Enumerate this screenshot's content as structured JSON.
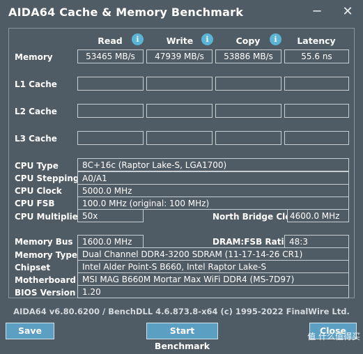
{
  "window": {
    "title": "AIDA64 Cache & Memory Benchmark",
    "minimize_glyph": "─",
    "close_glyph": "✕"
  },
  "columns": {
    "read": "Read",
    "write": "Write",
    "copy": "Copy",
    "latency": "Latency",
    "info_glyph": "i"
  },
  "rows": {
    "memory": {
      "label": "Memory",
      "read": "53465 MB/s",
      "write": "47939 MB/s",
      "copy": "53886 MB/s",
      "latency": "55.6 ns"
    },
    "l1": {
      "label": "L1 Cache",
      "read": "",
      "write": "",
      "copy": "",
      "latency": ""
    },
    "l2": {
      "label": "L2 Cache",
      "read": "",
      "write": "",
      "copy": "",
      "latency": ""
    },
    "l3": {
      "label": "L3 Cache",
      "read": "",
      "write": "",
      "copy": "",
      "latency": ""
    }
  },
  "cpu": {
    "type_label": "CPU Type",
    "type_value": "8C+16c   (Raptor Lake-S, LGA1700)",
    "stepping_label": "CPU Stepping",
    "stepping_value": "A0/A1",
    "clock_label": "CPU Clock",
    "clock_value": "5000.0 MHz",
    "fsb_label": "CPU FSB",
    "fsb_value": "100.0 MHz  (original: 100 MHz)",
    "multiplier_label": "CPU Multiplier",
    "multiplier_value": "50x",
    "nb_clock_label": "North Bridge Clock",
    "nb_clock_value": "4600.0 MHz"
  },
  "system": {
    "membus_label": "Memory Bus",
    "membus_value": "1600.0 MHz",
    "dram_ratio_label": "DRAM:FSB Ratio",
    "dram_ratio_value": "48:3",
    "memtype_label": "Memory Type",
    "memtype_value": "Dual Channel DDR4-3200 SDRAM  (11-17-14-26 CR1)",
    "chipset_label": "Chipset",
    "chipset_value": "Intel Alder Point-S B660, Intel Raptor Lake-S",
    "motherboard_label": "Motherboard",
    "motherboard_value": "MSI MAG B660M Mortar Max WiFi DDR4 (MS-7D97)",
    "bios_label": "BIOS Version",
    "bios_value": "1.20"
  },
  "footer": "AIDA64 v6.80.6200 / BenchDLL 4.6.873.8-x64  (c) 1995-2022 FinalWire Ltd.",
  "buttons": {
    "save": "Save",
    "start": "Start Benchmark",
    "close": "Close"
  },
  "watermark": "值 什么值得买"
}
